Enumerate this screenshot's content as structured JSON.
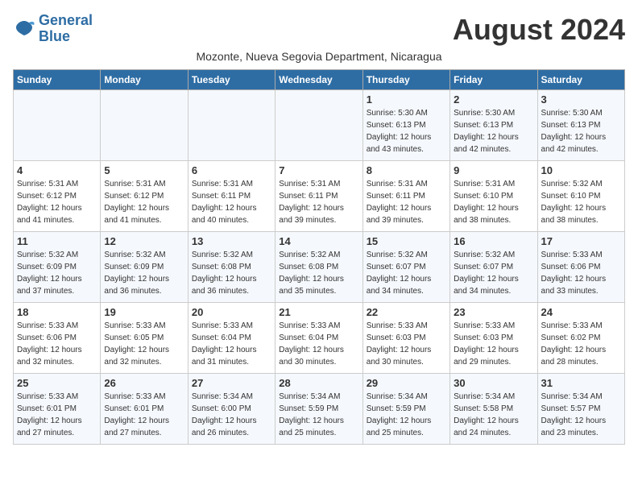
{
  "header": {
    "logo_line1": "General",
    "logo_line2": "Blue",
    "month_title": "August 2024",
    "subtitle": "Mozonte, Nueva Segovia Department, Nicaragua"
  },
  "weekdays": [
    "Sunday",
    "Monday",
    "Tuesday",
    "Wednesday",
    "Thursday",
    "Friday",
    "Saturday"
  ],
  "weeks": [
    [
      {
        "day": "",
        "info": ""
      },
      {
        "day": "",
        "info": ""
      },
      {
        "day": "",
        "info": ""
      },
      {
        "day": "",
        "info": ""
      },
      {
        "day": "1",
        "info": "Sunrise: 5:30 AM\nSunset: 6:13 PM\nDaylight: 12 hours\nand 43 minutes."
      },
      {
        "day": "2",
        "info": "Sunrise: 5:30 AM\nSunset: 6:13 PM\nDaylight: 12 hours\nand 42 minutes."
      },
      {
        "day": "3",
        "info": "Sunrise: 5:30 AM\nSunset: 6:13 PM\nDaylight: 12 hours\nand 42 minutes."
      }
    ],
    [
      {
        "day": "4",
        "info": "Sunrise: 5:31 AM\nSunset: 6:12 PM\nDaylight: 12 hours\nand 41 minutes."
      },
      {
        "day": "5",
        "info": "Sunrise: 5:31 AM\nSunset: 6:12 PM\nDaylight: 12 hours\nand 41 minutes."
      },
      {
        "day": "6",
        "info": "Sunrise: 5:31 AM\nSunset: 6:11 PM\nDaylight: 12 hours\nand 40 minutes."
      },
      {
        "day": "7",
        "info": "Sunrise: 5:31 AM\nSunset: 6:11 PM\nDaylight: 12 hours\nand 39 minutes."
      },
      {
        "day": "8",
        "info": "Sunrise: 5:31 AM\nSunset: 6:11 PM\nDaylight: 12 hours\nand 39 minutes."
      },
      {
        "day": "9",
        "info": "Sunrise: 5:31 AM\nSunset: 6:10 PM\nDaylight: 12 hours\nand 38 minutes."
      },
      {
        "day": "10",
        "info": "Sunrise: 5:32 AM\nSunset: 6:10 PM\nDaylight: 12 hours\nand 38 minutes."
      }
    ],
    [
      {
        "day": "11",
        "info": "Sunrise: 5:32 AM\nSunset: 6:09 PM\nDaylight: 12 hours\nand 37 minutes."
      },
      {
        "day": "12",
        "info": "Sunrise: 5:32 AM\nSunset: 6:09 PM\nDaylight: 12 hours\nand 36 minutes."
      },
      {
        "day": "13",
        "info": "Sunrise: 5:32 AM\nSunset: 6:08 PM\nDaylight: 12 hours\nand 36 minutes."
      },
      {
        "day": "14",
        "info": "Sunrise: 5:32 AM\nSunset: 6:08 PM\nDaylight: 12 hours\nand 35 minutes."
      },
      {
        "day": "15",
        "info": "Sunrise: 5:32 AM\nSunset: 6:07 PM\nDaylight: 12 hours\nand 34 minutes."
      },
      {
        "day": "16",
        "info": "Sunrise: 5:32 AM\nSunset: 6:07 PM\nDaylight: 12 hours\nand 34 minutes."
      },
      {
        "day": "17",
        "info": "Sunrise: 5:33 AM\nSunset: 6:06 PM\nDaylight: 12 hours\nand 33 minutes."
      }
    ],
    [
      {
        "day": "18",
        "info": "Sunrise: 5:33 AM\nSunset: 6:06 PM\nDaylight: 12 hours\nand 32 minutes."
      },
      {
        "day": "19",
        "info": "Sunrise: 5:33 AM\nSunset: 6:05 PM\nDaylight: 12 hours\nand 32 minutes."
      },
      {
        "day": "20",
        "info": "Sunrise: 5:33 AM\nSunset: 6:04 PM\nDaylight: 12 hours\nand 31 minutes."
      },
      {
        "day": "21",
        "info": "Sunrise: 5:33 AM\nSunset: 6:04 PM\nDaylight: 12 hours\nand 30 minutes."
      },
      {
        "day": "22",
        "info": "Sunrise: 5:33 AM\nSunset: 6:03 PM\nDaylight: 12 hours\nand 30 minutes."
      },
      {
        "day": "23",
        "info": "Sunrise: 5:33 AM\nSunset: 6:03 PM\nDaylight: 12 hours\nand 29 minutes."
      },
      {
        "day": "24",
        "info": "Sunrise: 5:33 AM\nSunset: 6:02 PM\nDaylight: 12 hours\nand 28 minutes."
      }
    ],
    [
      {
        "day": "25",
        "info": "Sunrise: 5:33 AM\nSunset: 6:01 PM\nDaylight: 12 hours\nand 27 minutes."
      },
      {
        "day": "26",
        "info": "Sunrise: 5:33 AM\nSunset: 6:01 PM\nDaylight: 12 hours\nand 27 minutes."
      },
      {
        "day": "27",
        "info": "Sunrise: 5:34 AM\nSunset: 6:00 PM\nDaylight: 12 hours\nand 26 minutes."
      },
      {
        "day": "28",
        "info": "Sunrise: 5:34 AM\nSunset: 5:59 PM\nDaylight: 12 hours\nand 25 minutes."
      },
      {
        "day": "29",
        "info": "Sunrise: 5:34 AM\nSunset: 5:59 PM\nDaylight: 12 hours\nand 25 minutes."
      },
      {
        "day": "30",
        "info": "Sunrise: 5:34 AM\nSunset: 5:58 PM\nDaylight: 12 hours\nand 24 minutes."
      },
      {
        "day": "31",
        "info": "Sunrise: 5:34 AM\nSunset: 5:57 PM\nDaylight: 12 hours\nand 23 minutes."
      }
    ]
  ]
}
